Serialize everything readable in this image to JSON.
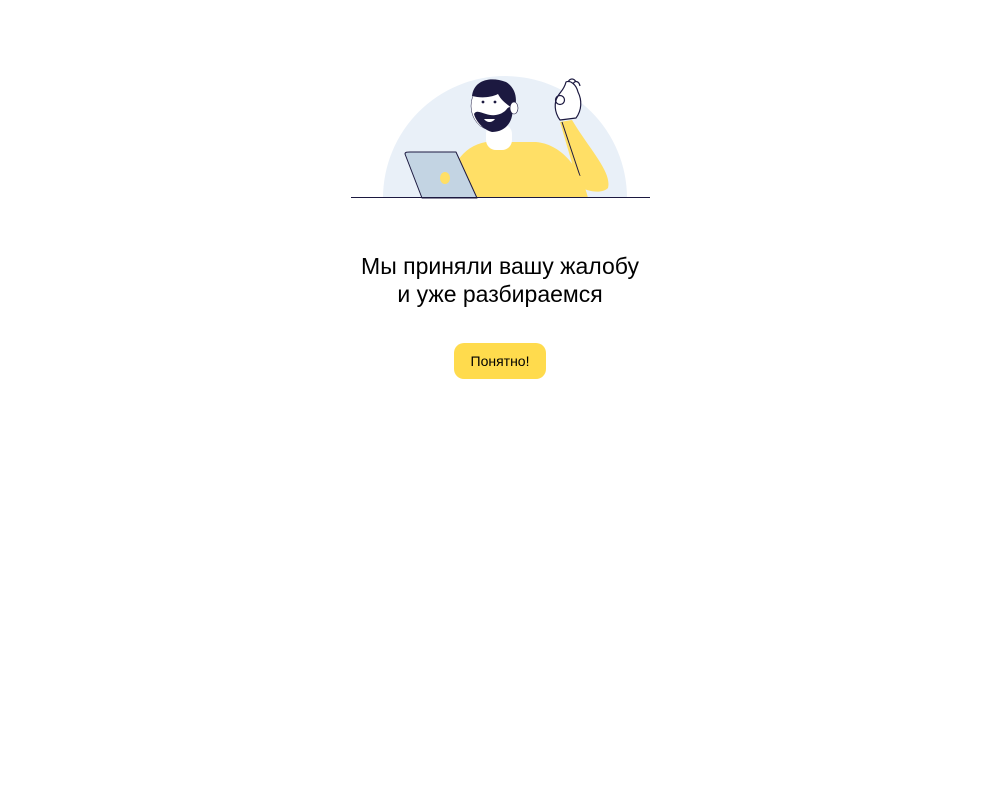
{
  "illustration": {
    "icon": "person-with-laptop-illustration",
    "colors": {
      "circle": "#e9f0f8",
      "sweater": "#ffdf66",
      "hair": "#1c1940",
      "laptop": "#c3d4e3",
      "line": "#1c1940"
    }
  },
  "message": {
    "line1": "Мы приняли вашу жалобу",
    "line2": "и уже разбираемся"
  },
  "actions": {
    "ok_label": "Понятно!"
  },
  "colors": {
    "accent": "#ffdb4d",
    "text": "#000000"
  }
}
